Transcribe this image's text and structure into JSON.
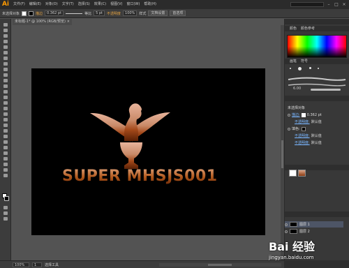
{
  "app": {
    "logo": "Ai"
  },
  "menu": [
    {
      "id": "file",
      "label": "文件(F)"
    },
    {
      "id": "edit",
      "label": "编辑(E)"
    },
    {
      "id": "object",
      "label": "对象(O)"
    },
    {
      "id": "type",
      "label": "文字(T)"
    },
    {
      "id": "select",
      "label": "选择(S)"
    },
    {
      "id": "effect",
      "label": "效果(C)"
    },
    {
      "id": "view",
      "label": "视图(V)"
    },
    {
      "id": "window",
      "label": "窗口(W)"
    },
    {
      "id": "help",
      "label": "帮助(H)"
    }
  ],
  "control": {
    "selection_label": "未选择对象",
    "stroke_label": "描边",
    "stroke_weight": "0.362 pt",
    "brush_label": "等比",
    "brush_size": "5 pt",
    "opacity_label": "不透明度",
    "opacity_value": "100%",
    "style_label": "样式",
    "doc_setup_button": "文档设置",
    "prefs_button": "首选项",
    "fill_color": "#ffffff",
    "stroke_color": "#000000"
  },
  "document": {
    "tab_title": "未标题-1* @ 100% (RGB/预览)",
    "close": "×",
    "artwork_text": "SUPER MHSJS001",
    "artwork_colors": {
      "light": "#dca68a",
      "mid": "#b05a1e",
      "dark": "#6e2a08"
    }
  },
  "panels": {
    "color_tabs": [
      "颜色",
      "颜色参考"
    ],
    "brush_tabs": [
      "画笔",
      "符号"
    ],
    "stroke_value": "6.00",
    "appearance": {
      "title": "未选择对象",
      "stroke_label": "描边:",
      "stroke_value": "0.362 pt",
      "opacity_link": "不透明度:",
      "opacity_value": "默认值",
      "fill_label": "填色:",
      "fill_opacity_value": "默认值",
      "global_opacity_value": "默认值"
    },
    "layers": [
      {
        "name": "图层 1"
      },
      {
        "name": "图层 2"
      }
    ]
  },
  "status": {
    "zoom": "100%",
    "page": "1",
    "tool_text": "选择工具"
  },
  "watermark": {
    "main": "Bai 经验",
    "sub": "jingyan.baidu.com"
  }
}
